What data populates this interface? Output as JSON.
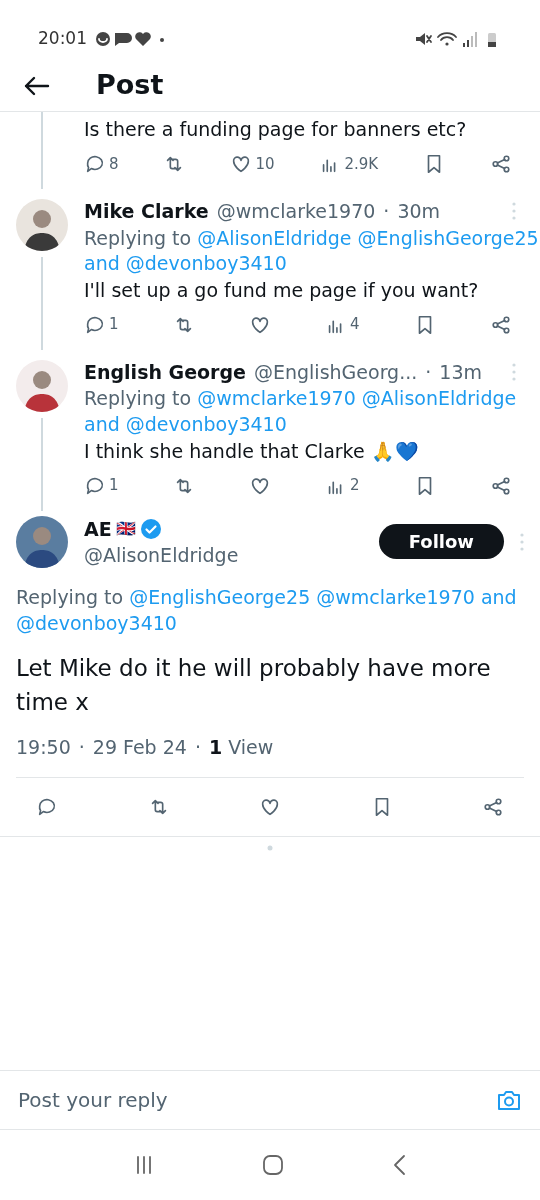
{
  "status_bar": {
    "time": "20:01"
  },
  "header": {
    "title": "Post"
  },
  "partial_post": {
    "text": "Is there a funding page for banners etc?",
    "actions": [
      {
        "kind": "reply",
        "count": "8"
      },
      {
        "kind": "repost"
      },
      {
        "kind": "like",
        "count": "10"
      },
      {
        "kind": "views",
        "count": "2.9K"
      },
      {
        "kind": "bookmark"
      },
      {
        "kind": "share"
      }
    ]
  },
  "replies": [
    {
      "name": "Mike Clarke",
      "handle": "@wmclarke1970",
      "separator": "·",
      "time": "30m",
      "replying_label": "Replying to",
      "mentions": [
        "@AlisonEldridge",
        "@EnglishGeorge25",
        "@devonboy3410"
      ],
      "conjunction": "and",
      "text": "I'll set up a go fund me page if you want?",
      "actions": [
        {
          "kind": "reply",
          "count": "1"
        },
        {
          "kind": "repost"
        },
        {
          "kind": "like"
        },
        {
          "kind": "views",
          "count": "4"
        },
        {
          "kind": "bookmark"
        },
        {
          "kind": "share"
        }
      ]
    },
    {
      "name": "English George",
      "handle": "@EnglishGeorg...",
      "separator": "·",
      "time": "13m",
      "replying_label": "Replying to",
      "mentions": [
        "@wmclarke1970",
        "@AlisonEldridge",
        "@devonboy3410"
      ],
      "conjunction": "and",
      "text": "I think she handle that Clarke 🙏💙",
      "actions": [
        {
          "kind": "reply",
          "count": "1"
        },
        {
          "kind": "repost"
        },
        {
          "kind": "like"
        },
        {
          "kind": "views",
          "count": "2"
        },
        {
          "kind": "bookmark"
        },
        {
          "kind": "share"
        }
      ]
    }
  ],
  "main_post": {
    "name": "AE",
    "flag": "🇬🇧",
    "verified": true,
    "handle": "@AlisonEldridge",
    "follow_label": "Follow",
    "replying_label": "Replying to",
    "mentions": [
      "@EnglishGeorge25",
      "@wmclarke1970",
      "@devonboy3410"
    ],
    "conjunction": "and",
    "text": "Let Mike do it he will probably have more time x",
    "time": "19:50",
    "separator": "·",
    "date": "29 Feb 24",
    "views_count": "1",
    "views_label": "View",
    "actions": [
      {
        "kind": "reply"
      },
      {
        "kind": "repost"
      },
      {
        "kind": "like"
      },
      {
        "kind": "bookmark"
      },
      {
        "kind": "share"
      }
    ]
  },
  "composer": {
    "placeholder": "Post your reply"
  }
}
